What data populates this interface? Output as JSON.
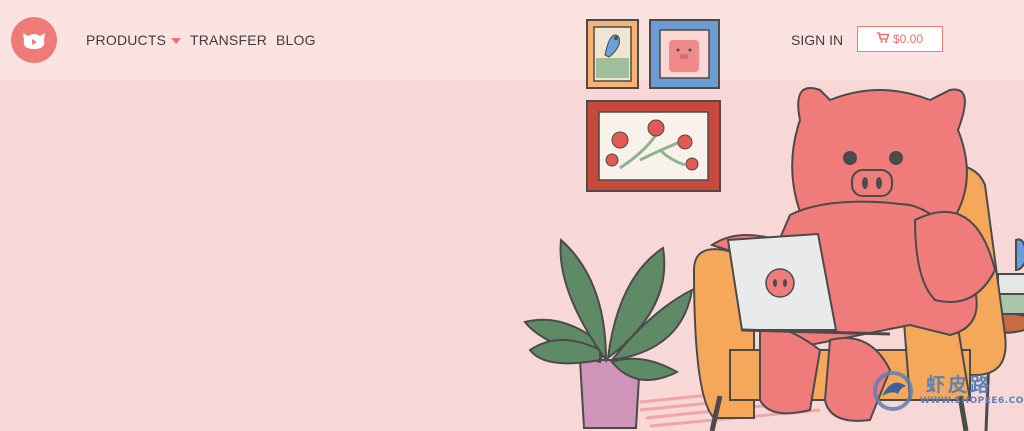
{
  "header": {
    "logo_icon": "pig-logo-icon",
    "nav": [
      {
        "label": "PRODUCTS",
        "has_dropdown": true
      },
      {
        "label": "TRANSFER"
      },
      {
        "label": "BLOG"
      }
    ],
    "signin_label": "SIGN IN",
    "cart": {
      "icon": "shopping-cart-icon",
      "total": "$0.00"
    }
  },
  "watermark": {
    "text": "虾皮路",
    "url": "WWW.SHOPEE6.COM"
  },
  "colors": {
    "background": "#f8d8d6",
    "header_background": "#fbe3e2",
    "accent": "#ef7b78",
    "pig": "#ef7b7b",
    "armchair": "#f6a85a",
    "plant": "#5f8a66",
    "pot": "#cf95b8"
  }
}
